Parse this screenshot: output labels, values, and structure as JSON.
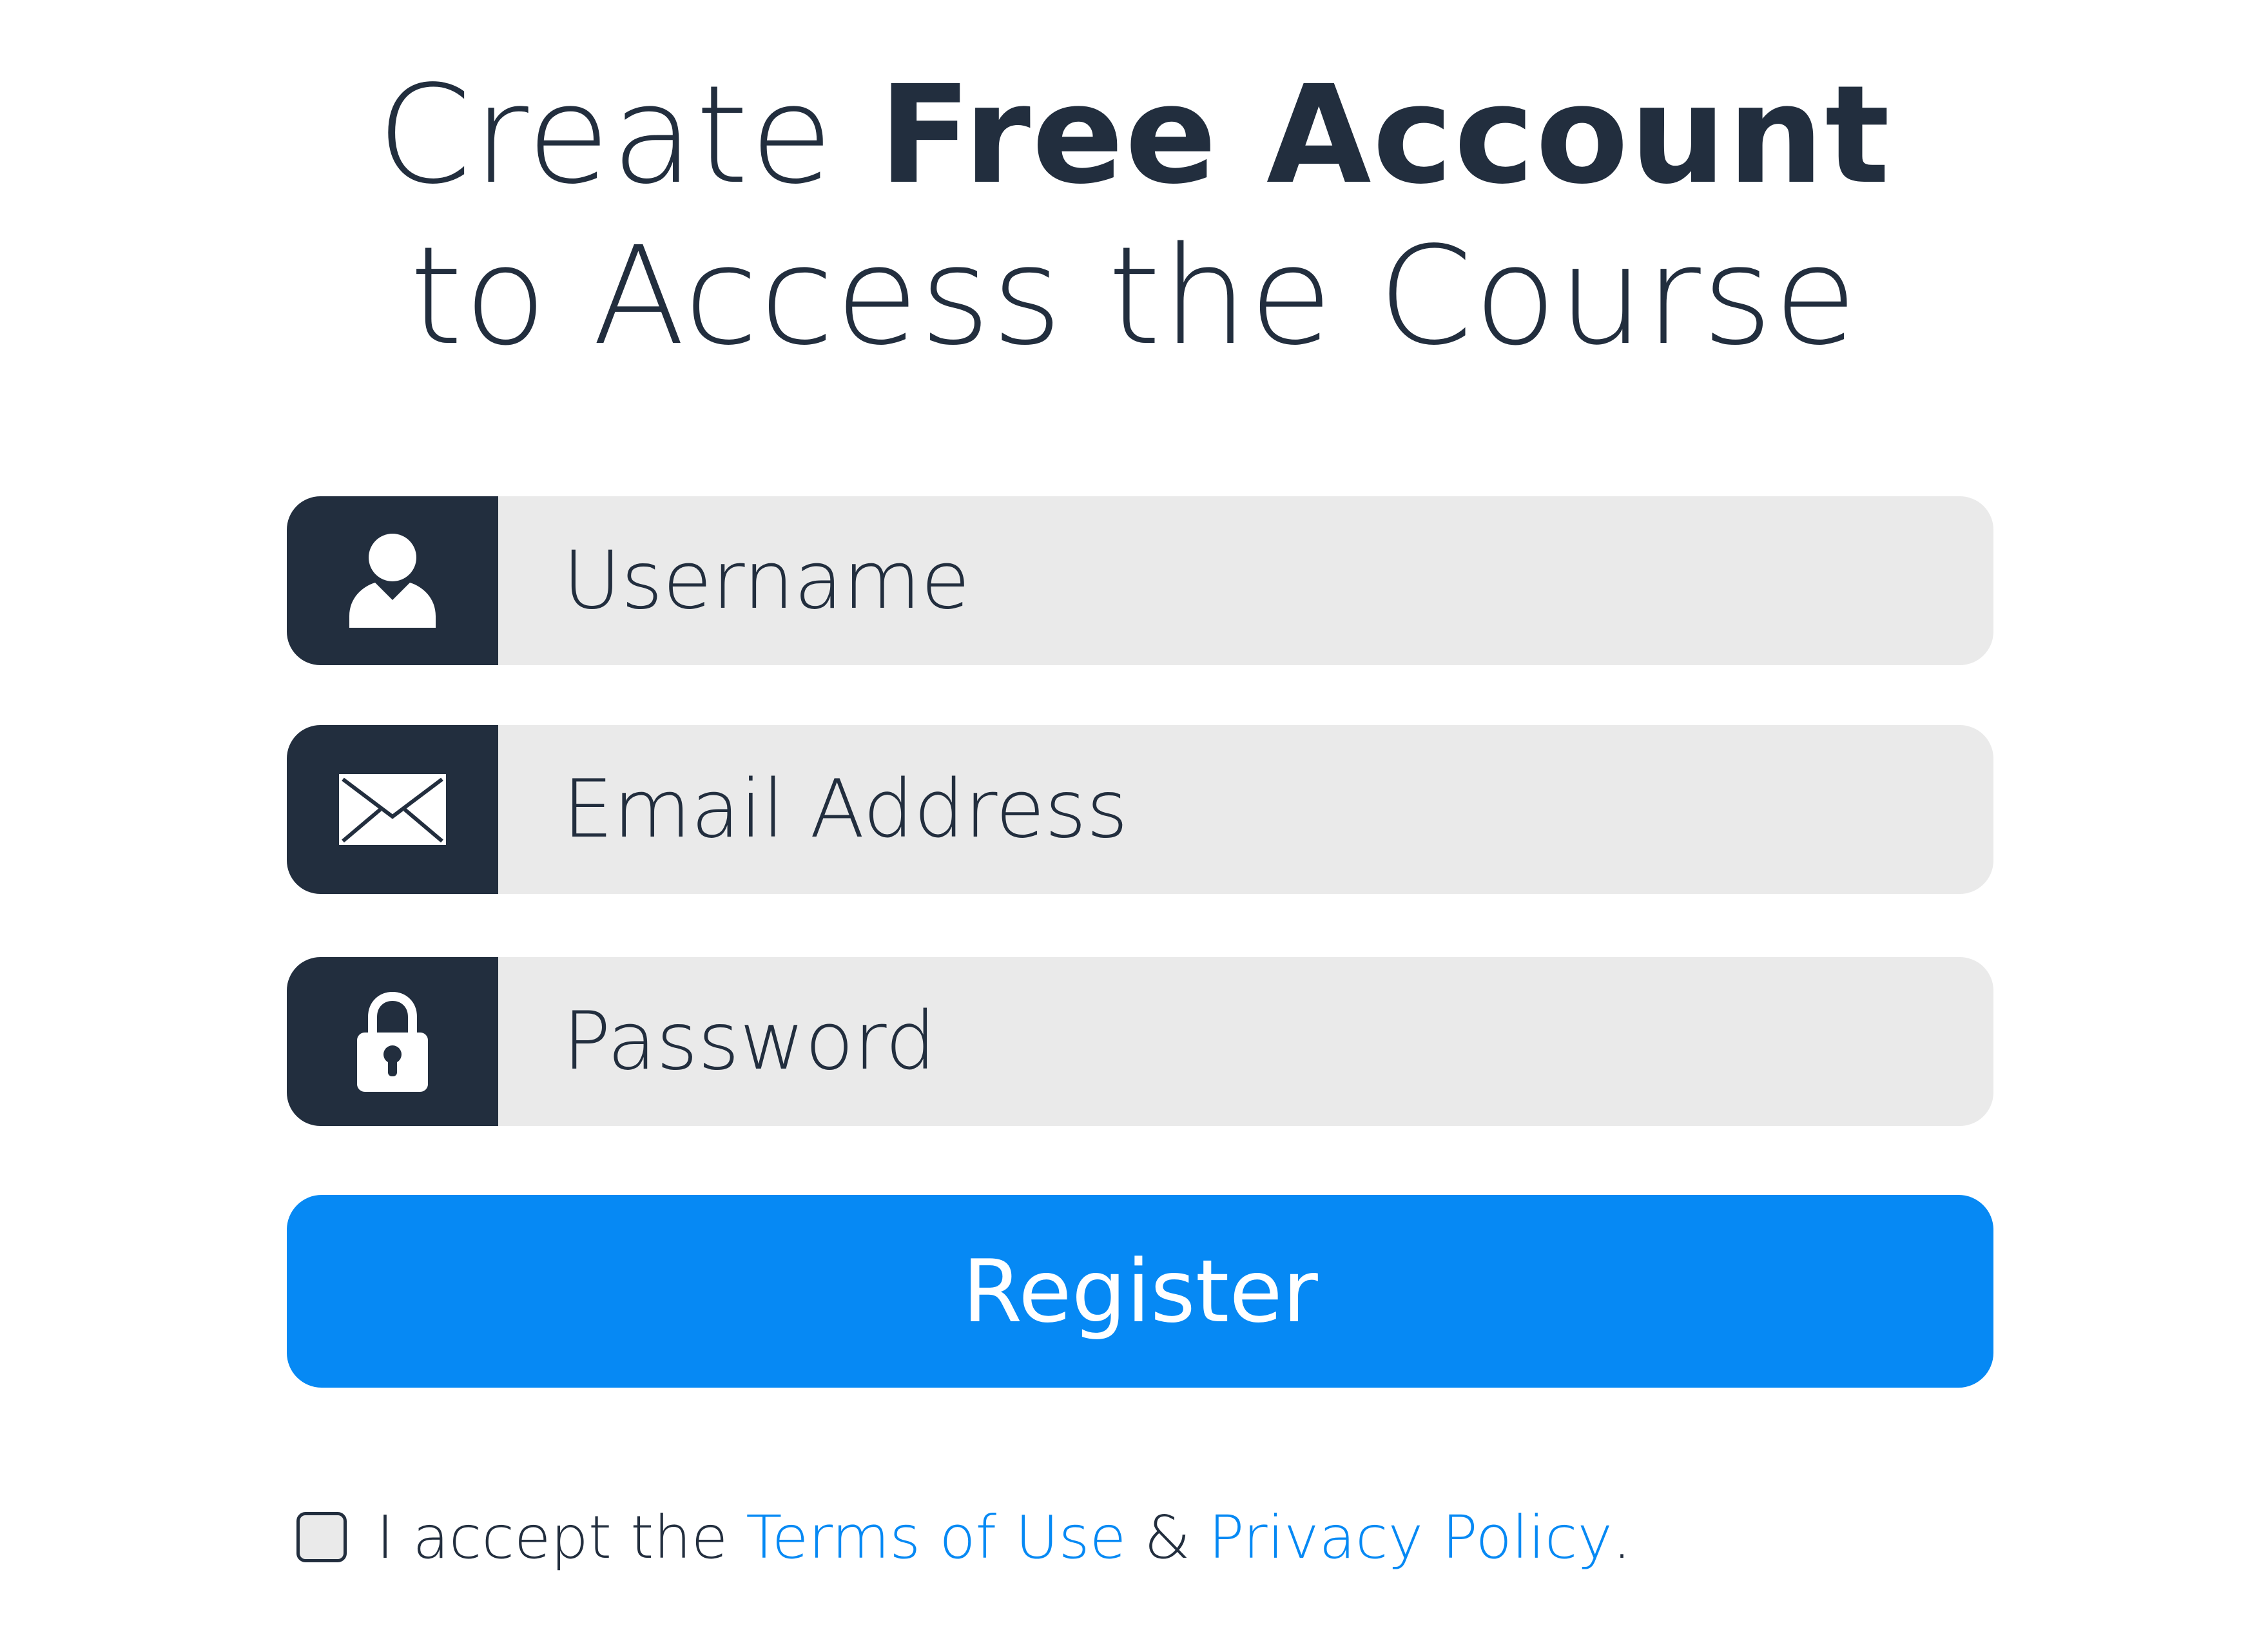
{
  "heading": {
    "prefix": "Create",
    "bold": "Free Account",
    "line2": "to Access the Course"
  },
  "form": {
    "username": {
      "placeholder": "Username",
      "icon": "user-icon"
    },
    "email": {
      "placeholder": "Email Address",
      "icon": "envelope-icon"
    },
    "password": {
      "placeholder": "Password",
      "icon": "lock-icon"
    },
    "register_label": "Register"
  },
  "terms": {
    "prefix": "I accept the",
    "terms_link": "Terms of Use",
    "conjunction": "&",
    "privacy_link": "Privacy Policy",
    "suffix": "."
  },
  "colors": {
    "dark": "#222e3e",
    "field_bg": "#eaeaea",
    "accent": "#0689f4"
  }
}
